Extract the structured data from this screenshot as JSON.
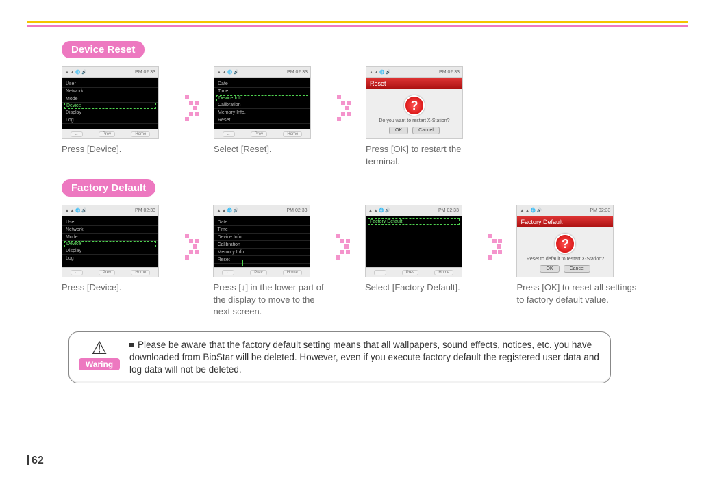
{
  "page_number": "62",
  "sections": {
    "device_reset": {
      "label": "Device Reset",
      "steps": [
        {
          "caption": "Press [Device]."
        },
        {
          "caption": "Select [Reset]."
        },
        {
          "caption": "Press [OK] to restart the terminal."
        }
      ],
      "list_items": [
        "User",
        "Network",
        "Mode",
        "Device",
        "Display",
        "Log"
      ],
      "list_items2": [
        "Date",
        "Time",
        "Device Info",
        "Calibration",
        "Memory Info.",
        "Reset"
      ],
      "statusbar_time": "PM 02:33",
      "dialog": {
        "title": "Reset",
        "text": "Do you want to restart X-Station?",
        "ok": "OK",
        "cancel": "Cancel"
      }
    },
    "factory_default": {
      "label": "Factory Default",
      "steps": [
        {
          "caption": "Press [Device]."
        },
        {
          "caption": "Press [↓] in the lower part of the display to move to the next screen."
        },
        {
          "caption": "Select [Factory Default]."
        },
        {
          "caption": "Press [OK] to reset all settings to factory default value."
        }
      ],
      "list3": [
        "Factory Default"
      ],
      "dialog": {
        "title": "Factory Default",
        "text": "Reset to default to restart X-Station?",
        "ok": "OK",
        "cancel": "Cancel"
      }
    }
  },
  "warning": {
    "label": "Waring",
    "text": "Please be aware that the factory default setting means that all wallpapers, sound effects, notices, etc. you have downloaded from BioStar will be deleted. However, even if you execute factory default the registered user data and log data will not be deleted."
  },
  "thumb_buttons": {
    "left": "←",
    "mid": "Prev",
    "right": "Home"
  }
}
